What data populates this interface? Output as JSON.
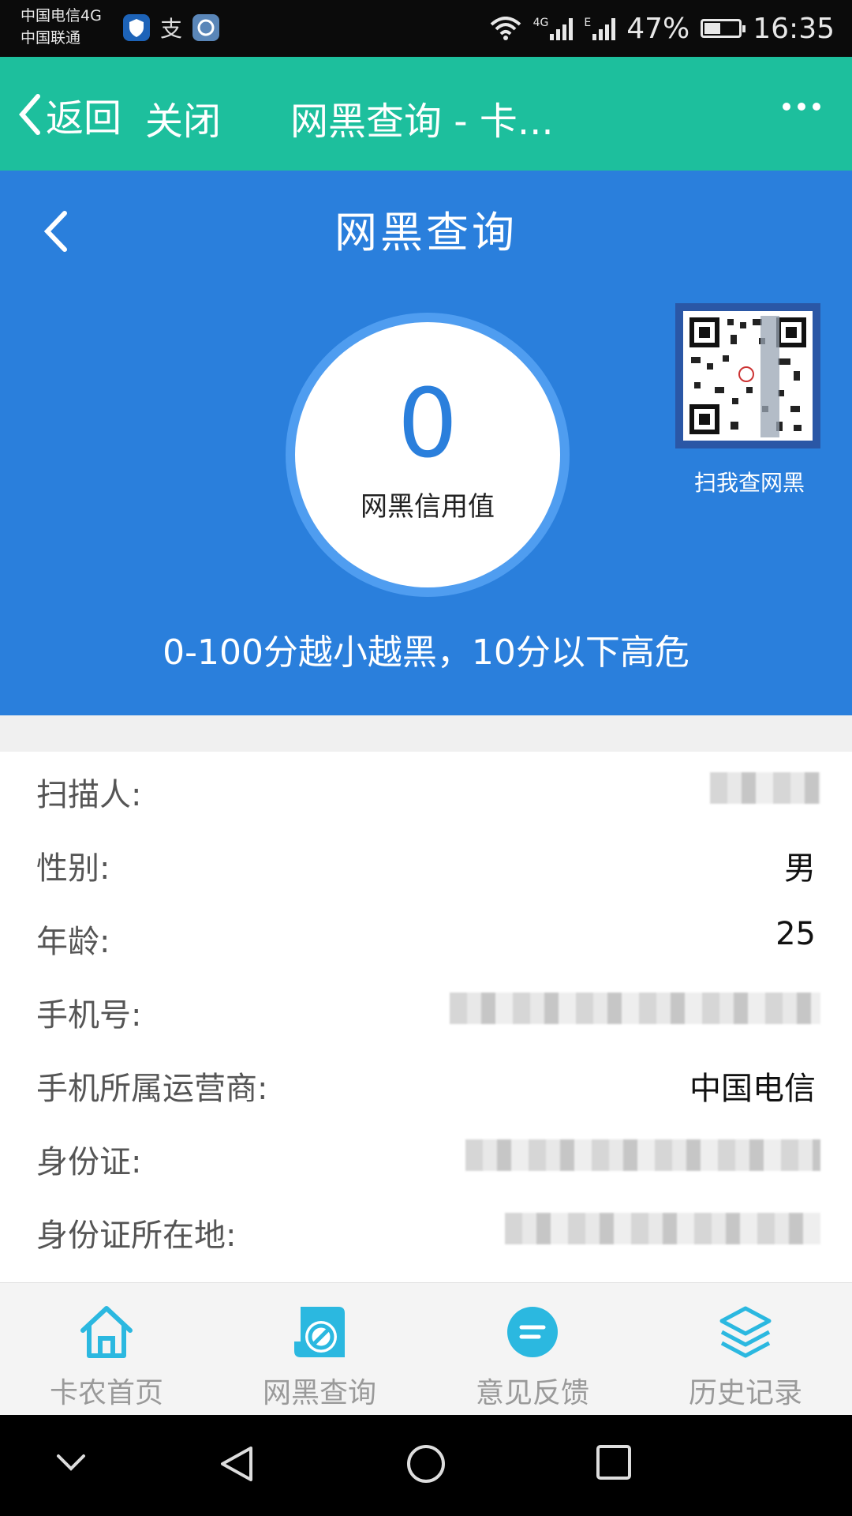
{
  "status_bar": {
    "carrier1": "中国电信4G",
    "carrier2": "中国联通",
    "net_4g": "4G",
    "net_e": "E",
    "battery": "47%",
    "battery_level": 0.47,
    "time": "16:35"
  },
  "webview_header": {
    "back_label": "返回",
    "close_label": "关闭",
    "title": "网黑查询 - 卡..."
  },
  "page": {
    "title": "网黑查询",
    "score": "0",
    "score_label": "网黑信用值",
    "qr_label": "扫我查网黑",
    "note": "0-100分越小越黑，10分以下高危"
  },
  "info": [
    {
      "label": "扫描人:",
      "value": ""
    },
    {
      "label": "性别:",
      "value": "男"
    },
    {
      "label": "年龄:",
      "value": "25"
    },
    {
      "label": "手机号:",
      "value": ""
    },
    {
      "label": "手机所属运营商:",
      "value": "中国电信"
    },
    {
      "label": "身份证:",
      "value": ""
    },
    {
      "label": "身份证所在地:",
      "value": ""
    }
  ],
  "tabs": [
    {
      "label": "卡农首页",
      "icon": "home-icon"
    },
    {
      "label": "网黑查询",
      "icon": "blacklist-query-icon"
    },
    {
      "label": "意见反馈",
      "icon": "feedback-icon"
    },
    {
      "label": "历史记录",
      "icon": "history-layers-icon"
    }
  ],
  "colors": {
    "header_green": "#1dbf9d",
    "hero_blue": "#2a7fdc",
    "tab_icon": "#2bb8e0"
  }
}
